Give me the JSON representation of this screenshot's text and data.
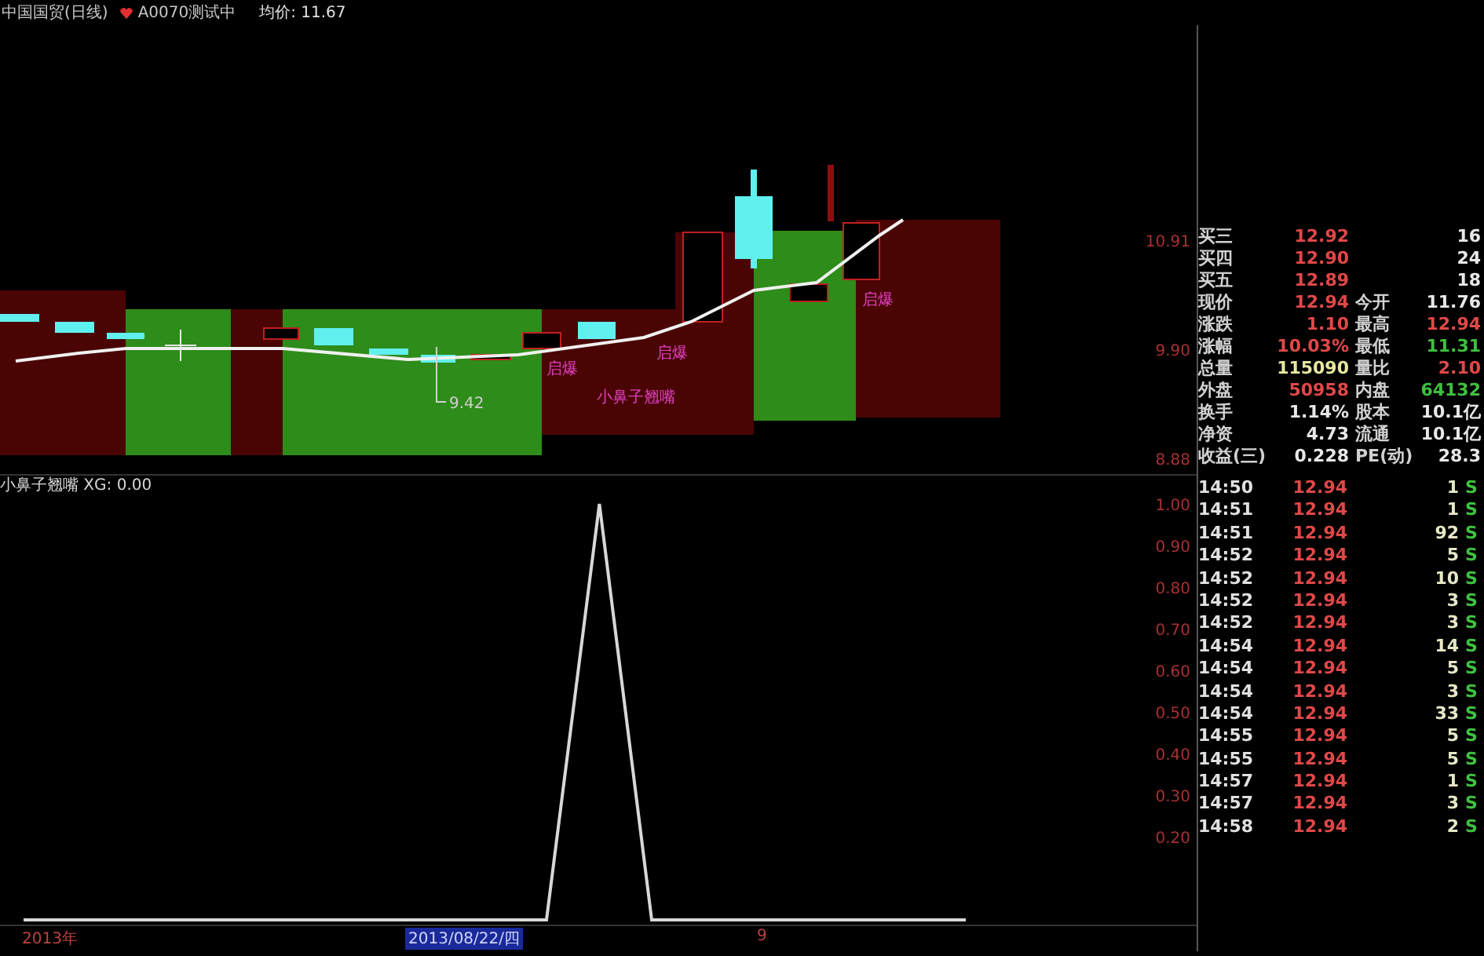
{
  "title_bar": {
    "stock": "中国国贸(日线)",
    "formula": "A0070测试中",
    "average": "均价: 11.67"
  },
  "price_chart": {
    "price_axis": [
      "10.91",
      "9.90",
      "8.88"
    ],
    "signals": [
      {
        "text": "启爆"
      },
      {
        "text": "启爆"
      },
      {
        "text": "启爆"
      }
    ],
    "pattern_label": "小鼻子翘嘴",
    "low_label": "9.42"
  },
  "indicator": {
    "title": "小鼻子翘嘴 XG: 0.00",
    "axis_labels": [
      "1.00",
      "0.90",
      "0.80",
      "0.70",
      "0.60",
      "0.50",
      "0.40",
      "0.30",
      "0.20"
    ]
  },
  "time_axis": [
    {
      "label": "2013年",
      "selected": false
    },
    {
      "label": "2013/08/22/四",
      "selected": true
    },
    {
      "label": "9",
      "selected": false
    }
  ],
  "quote": {
    "bids": [
      {
        "label": "买三",
        "price": "12.92",
        "volume": "16"
      },
      {
        "label": "买四",
        "price": "12.90",
        "volume": "24"
      },
      {
        "label": "买五",
        "price": "12.89",
        "volume": "18"
      }
    ],
    "stats": [
      {
        "cells": [
          {
            "label": "现价",
            "value": "12.94",
            "color": "#e04848"
          },
          {
            "label": "今开",
            "value": "11.76",
            "color": "#e8e8e8"
          }
        ]
      },
      {
        "cells": [
          {
            "label": "涨跌",
            "value": "1.10",
            "color": "#e04848"
          },
          {
            "label": "最高",
            "value": "12.94",
            "color": "#e04848"
          }
        ]
      },
      {
        "cells": [
          {
            "label": "涨幅",
            "value": "10.03%",
            "color": "#e04848"
          },
          {
            "label": "最低",
            "value": "11.31",
            "color": "#40c040"
          }
        ]
      },
      {
        "cells": [
          {
            "label": "总量",
            "value": "115090",
            "color": "#e8e8a0"
          },
          {
            "label": "量比",
            "value": "2.10",
            "color": "#e04848"
          }
        ]
      },
      {
        "cells": [
          {
            "label": "外盘",
            "value": "50958",
            "color": "#e04848"
          },
          {
            "label": "内盘",
            "value": "64132",
            "color": "#40c040"
          }
        ]
      },
      {
        "cells": [
          {
            "label": "换手",
            "value": "1.14%",
            "color": "#e8e8e8"
          },
          {
            "label": "股本",
            "value": "10.1亿",
            "color": "#e8e8e8"
          }
        ]
      },
      {
        "cells": [
          {
            "label": "净资",
            "value": "4.73",
            "color": "#e8e8e8"
          },
          {
            "label": "流通",
            "value": "10.1亿",
            "color": "#e8e8e8"
          }
        ]
      },
      {
        "cells": [
          {
            "label": "收益(三)",
            "value": "0.228",
            "color": "#e8e8e8"
          },
          {
            "label": "PE(动)",
            "value": "28.3",
            "color": "#e8e8e8"
          }
        ]
      }
    ],
    "ticks": [
      {
        "time": "14:50",
        "price": "12.94",
        "volume": "1",
        "side": "S"
      },
      {
        "time": "14:51",
        "price": "12.94",
        "volume": "1",
        "side": "S"
      },
      {
        "time": "14:51",
        "price": "12.94",
        "volume": "92",
        "side": "S"
      },
      {
        "time": "14:52",
        "price": "12.94",
        "volume": "5",
        "side": "S"
      },
      {
        "time": "14:52",
        "price": "12.94",
        "volume": "10",
        "side": "S"
      },
      {
        "time": "14:52",
        "price": "12.94",
        "volume": "3",
        "side": "S"
      },
      {
        "time": "14:52",
        "price": "12.94",
        "volume": "3",
        "side": "S"
      },
      {
        "time": "14:54",
        "price": "12.94",
        "volume": "14",
        "side": "S"
      },
      {
        "time": "14:54",
        "price": "12.94",
        "volume": "5",
        "side": "S"
      },
      {
        "time": "14:54",
        "price": "12.94",
        "volume": "3",
        "side": "S"
      },
      {
        "time": "14:54",
        "price": "12.94",
        "volume": "33",
        "side": "S"
      },
      {
        "time": "14:55",
        "price": "12.94",
        "volume": "5",
        "side": "S"
      },
      {
        "time": "14:55",
        "price": "12.94",
        "volume": "5",
        "side": "S"
      },
      {
        "time": "14:57",
        "price": "12.94",
        "volume": "1",
        "side": "S"
      },
      {
        "time": "14:57",
        "price": "12.94",
        "volume": "3",
        "side": "S"
      },
      {
        "time": "14:58",
        "price": "12.94",
        "volume": "2",
        "side": "S"
      }
    ]
  }
}
